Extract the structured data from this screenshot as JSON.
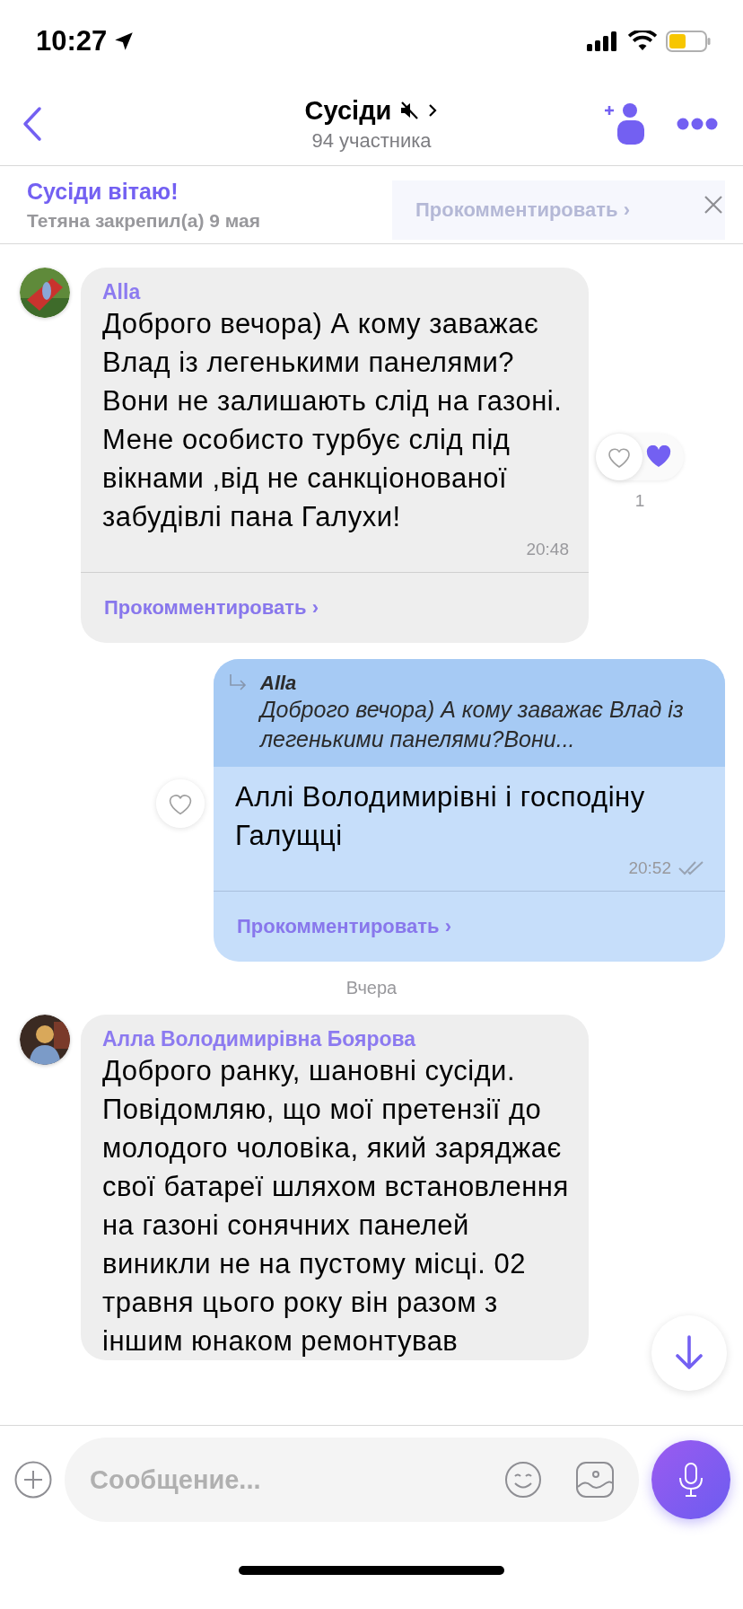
{
  "status_bar": {
    "time": "10:27"
  },
  "header": {
    "title": "Сусіди",
    "muted": true,
    "subtitle": "94 участника"
  },
  "pinned": {
    "title": "Сусіди вітаю!",
    "meta": "Тетяна закрепил(а) 9 мая",
    "ghost_action": "Прокомментировать ›"
  },
  "messages": [
    {
      "kind": "incoming",
      "sender": "Alla",
      "text": "Доброго вечора) А кому заважає Влад із легенькими панелями?Вони не залишають слід на газоні.\nМене особисто турбує слід під вікнами ,від не санкціонованої забудівлі пана Галухи!",
      "time": "20:48",
      "comment_label": "Прокомментировать ›",
      "liked": false,
      "reaction_count": "1"
    },
    {
      "kind": "outgoing",
      "quote": {
        "sender": "Alla",
        "text": "Доброго вечора) А кому заважає Влад із легенькими панелями?Вони..."
      },
      "text": "Аллі Володимирівні і господіну Галущці",
      "time": "20:52",
      "read": true,
      "comment_label": "Прокомментировать ›",
      "liked": false
    },
    {
      "kind": "date",
      "text": "Вчера"
    },
    {
      "kind": "incoming",
      "sender": "Алла Володимирівна Боярова",
      "text": "Доброго ранку, шановні сусіди. Повідомляю, що мої претензії до молодого чоловіка, який заряджає свої батареї шляхом встановлення на газоні сонячних панелей виникли не на пустому місці. 02 травня цього року він разом з іншим юнаком ремонтував"
    }
  ],
  "composer": {
    "placeholder": "Сообщение..."
  }
}
